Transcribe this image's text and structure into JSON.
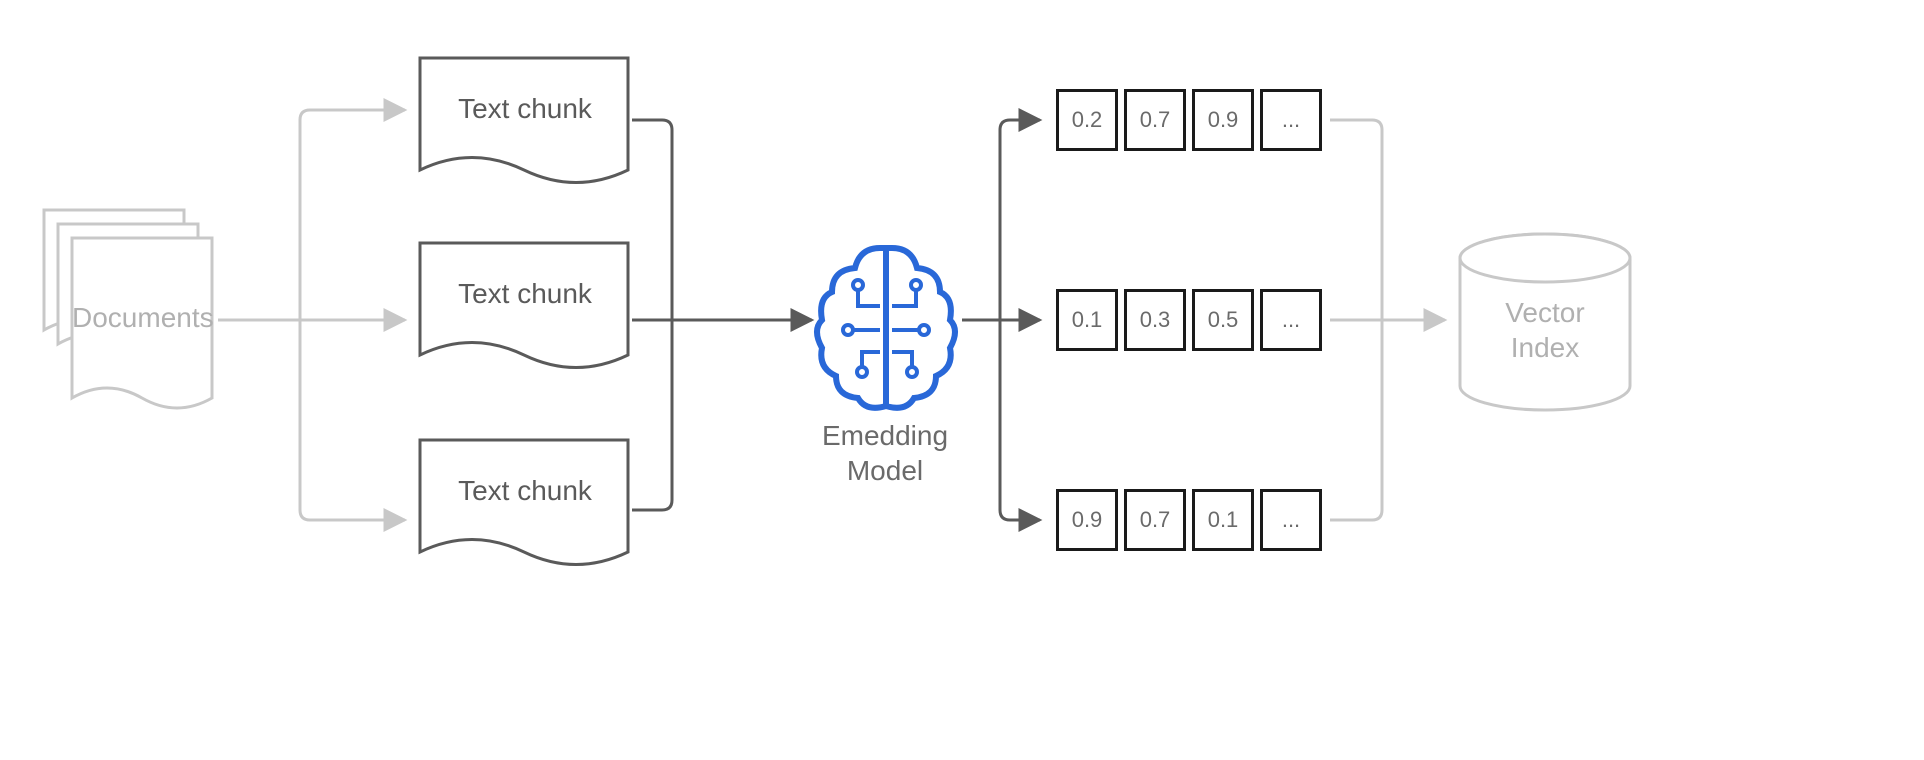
{
  "documents_label": "Documents",
  "chunks": [
    "Text chunk",
    "Text chunk",
    "Text chunk"
  ],
  "model_label_line1": "Emedding",
  "model_label_line2": "Model",
  "vectors": [
    [
      "0.2",
      "0.7",
      "0.9",
      "..."
    ],
    [
      "0.1",
      "0.3",
      "0.5",
      "..."
    ],
    [
      "0.9",
      "0.7",
      "0.1",
      "..."
    ]
  ],
  "index_label_line1": "Vector",
  "index_label_line2": "Index",
  "colors": {
    "gray": "#c8c8c8",
    "darkgray": "#6a6a6a",
    "blue": "#2968d8",
    "black": "#1a1a1a"
  }
}
